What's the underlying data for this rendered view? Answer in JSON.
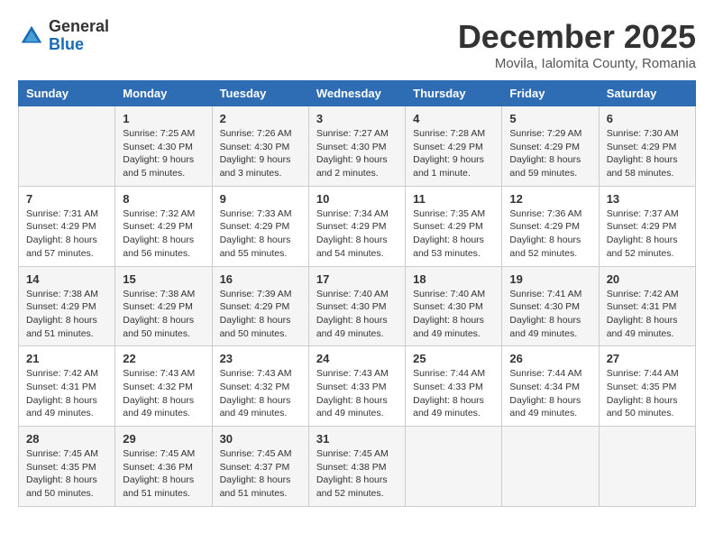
{
  "logo": {
    "general": "General",
    "blue": "Blue"
  },
  "title": "December 2025",
  "subtitle": "Movila, Ialomita County, Romania",
  "days_of_week": [
    "Sunday",
    "Monday",
    "Tuesday",
    "Wednesday",
    "Thursday",
    "Friday",
    "Saturday"
  ],
  "weeks": [
    [
      {
        "day": "",
        "info": ""
      },
      {
        "day": "1",
        "info": "Sunrise: 7:25 AM\nSunset: 4:30 PM\nDaylight: 9 hours\nand 5 minutes."
      },
      {
        "day": "2",
        "info": "Sunrise: 7:26 AM\nSunset: 4:30 PM\nDaylight: 9 hours\nand 3 minutes."
      },
      {
        "day": "3",
        "info": "Sunrise: 7:27 AM\nSunset: 4:30 PM\nDaylight: 9 hours\nand 2 minutes."
      },
      {
        "day": "4",
        "info": "Sunrise: 7:28 AM\nSunset: 4:29 PM\nDaylight: 9 hours\nand 1 minute."
      },
      {
        "day": "5",
        "info": "Sunrise: 7:29 AM\nSunset: 4:29 PM\nDaylight: 8 hours\nand 59 minutes."
      },
      {
        "day": "6",
        "info": "Sunrise: 7:30 AM\nSunset: 4:29 PM\nDaylight: 8 hours\nand 58 minutes."
      }
    ],
    [
      {
        "day": "7",
        "info": "Sunrise: 7:31 AM\nSunset: 4:29 PM\nDaylight: 8 hours\nand 57 minutes."
      },
      {
        "day": "8",
        "info": "Sunrise: 7:32 AM\nSunset: 4:29 PM\nDaylight: 8 hours\nand 56 minutes."
      },
      {
        "day": "9",
        "info": "Sunrise: 7:33 AM\nSunset: 4:29 PM\nDaylight: 8 hours\nand 55 minutes."
      },
      {
        "day": "10",
        "info": "Sunrise: 7:34 AM\nSunset: 4:29 PM\nDaylight: 8 hours\nand 54 minutes."
      },
      {
        "day": "11",
        "info": "Sunrise: 7:35 AM\nSunset: 4:29 PM\nDaylight: 8 hours\nand 53 minutes."
      },
      {
        "day": "12",
        "info": "Sunrise: 7:36 AM\nSunset: 4:29 PM\nDaylight: 8 hours\nand 52 minutes."
      },
      {
        "day": "13",
        "info": "Sunrise: 7:37 AM\nSunset: 4:29 PM\nDaylight: 8 hours\nand 52 minutes."
      }
    ],
    [
      {
        "day": "14",
        "info": "Sunrise: 7:38 AM\nSunset: 4:29 PM\nDaylight: 8 hours\nand 51 minutes."
      },
      {
        "day": "15",
        "info": "Sunrise: 7:38 AM\nSunset: 4:29 PM\nDaylight: 8 hours\nand 50 minutes."
      },
      {
        "day": "16",
        "info": "Sunrise: 7:39 AM\nSunset: 4:29 PM\nDaylight: 8 hours\nand 50 minutes."
      },
      {
        "day": "17",
        "info": "Sunrise: 7:40 AM\nSunset: 4:30 PM\nDaylight: 8 hours\nand 49 minutes."
      },
      {
        "day": "18",
        "info": "Sunrise: 7:40 AM\nSunset: 4:30 PM\nDaylight: 8 hours\nand 49 minutes."
      },
      {
        "day": "19",
        "info": "Sunrise: 7:41 AM\nSunset: 4:30 PM\nDaylight: 8 hours\nand 49 minutes."
      },
      {
        "day": "20",
        "info": "Sunrise: 7:42 AM\nSunset: 4:31 PM\nDaylight: 8 hours\nand 49 minutes."
      }
    ],
    [
      {
        "day": "21",
        "info": "Sunrise: 7:42 AM\nSunset: 4:31 PM\nDaylight: 8 hours\nand 49 minutes."
      },
      {
        "day": "22",
        "info": "Sunrise: 7:43 AM\nSunset: 4:32 PM\nDaylight: 8 hours\nand 49 minutes."
      },
      {
        "day": "23",
        "info": "Sunrise: 7:43 AM\nSunset: 4:32 PM\nDaylight: 8 hours\nand 49 minutes."
      },
      {
        "day": "24",
        "info": "Sunrise: 7:43 AM\nSunset: 4:33 PM\nDaylight: 8 hours\nand 49 minutes."
      },
      {
        "day": "25",
        "info": "Sunrise: 7:44 AM\nSunset: 4:33 PM\nDaylight: 8 hours\nand 49 minutes."
      },
      {
        "day": "26",
        "info": "Sunrise: 7:44 AM\nSunset: 4:34 PM\nDaylight: 8 hours\nand 49 minutes."
      },
      {
        "day": "27",
        "info": "Sunrise: 7:44 AM\nSunset: 4:35 PM\nDaylight: 8 hours\nand 50 minutes."
      }
    ],
    [
      {
        "day": "28",
        "info": "Sunrise: 7:45 AM\nSunset: 4:35 PM\nDaylight: 8 hours\nand 50 minutes."
      },
      {
        "day": "29",
        "info": "Sunrise: 7:45 AM\nSunset: 4:36 PM\nDaylight: 8 hours\nand 51 minutes."
      },
      {
        "day": "30",
        "info": "Sunrise: 7:45 AM\nSunset: 4:37 PM\nDaylight: 8 hours\nand 51 minutes."
      },
      {
        "day": "31",
        "info": "Sunrise: 7:45 AM\nSunset: 4:38 PM\nDaylight: 8 hours\nand 52 minutes."
      },
      {
        "day": "",
        "info": ""
      },
      {
        "day": "",
        "info": ""
      },
      {
        "day": "",
        "info": ""
      }
    ]
  ]
}
